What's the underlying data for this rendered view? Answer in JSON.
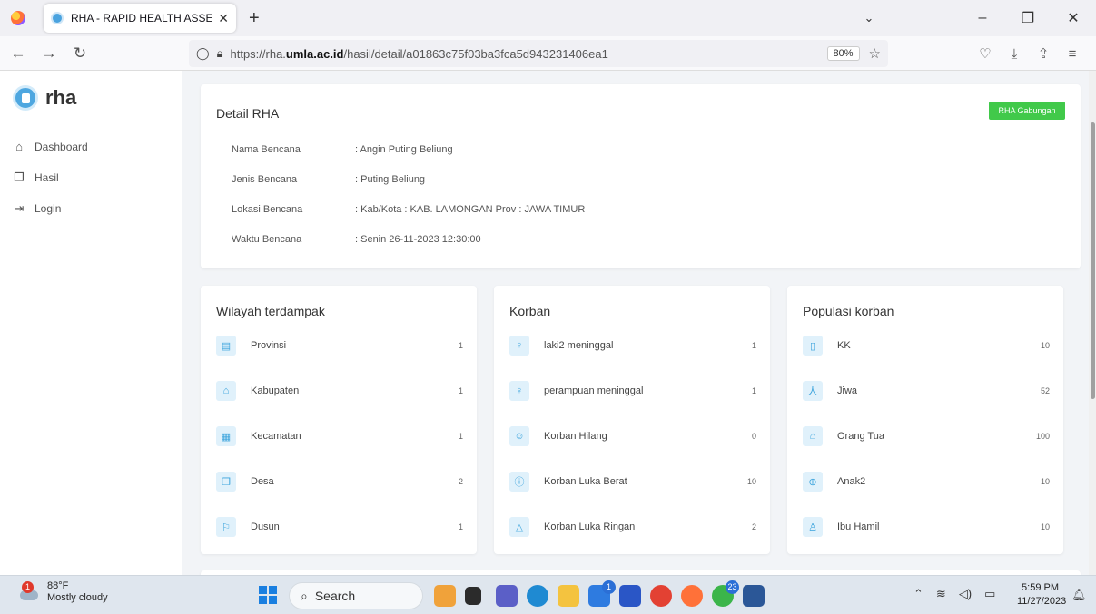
{
  "browser": {
    "tab_title": "RHA - RAPID HEALTH ASSESSM",
    "tab_close": "✕",
    "new_tab": "+",
    "url_prefix": "https://rha.",
    "url_domain": "umla.ac.id",
    "url_path": "/hasil/detail/a01863c75f03ba3fca5d943231406ea1",
    "zoom": "80%"
  },
  "sidebar": {
    "brand": "rha",
    "items": [
      {
        "label": "Dashboard",
        "icon": "home-icon"
      },
      {
        "label": "Hasil",
        "icon": "copy-icon"
      },
      {
        "label": "Login",
        "icon": "login-icon"
      }
    ]
  },
  "detail": {
    "title": "Detail RHA",
    "button": "RHA Gabungan",
    "rows": [
      {
        "label": "Nama Bencana",
        "value": ": Angin Puting Beliung"
      },
      {
        "label": "Jenis Bencana",
        "value": ": Puting Beliung"
      },
      {
        "label": "Lokasi Bencana",
        "value": ": Kab/Kota : KAB. LAMONGAN Prov : JAWA TIMUR"
      },
      {
        "label": "Waktu Bencana",
        "value": ": Senin 26-11-2023 12:30:00"
      }
    ]
  },
  "wilayah": {
    "title": "Wilayah terdampak",
    "items": [
      {
        "label": "Provinsi",
        "value": "1",
        "icon": "document-icon"
      },
      {
        "label": "Kabupaten",
        "value": "1",
        "icon": "home-icon"
      },
      {
        "label": "Kecamatan",
        "value": "1",
        "icon": "building-icon"
      },
      {
        "label": "Desa",
        "value": "2",
        "icon": "copy-icon"
      },
      {
        "label": "Dusun",
        "value": "1",
        "icon": "flag-icon"
      }
    ]
  },
  "korban": {
    "title": "Korban",
    "items": [
      {
        "label": "laki2 meninggal",
        "value": "1",
        "icon": "person-icon"
      },
      {
        "label": "perampuan meninggal",
        "value": "1",
        "icon": "person-icon"
      },
      {
        "label": "Korban Hilang",
        "value": "0",
        "icon": "user-search-icon"
      },
      {
        "label": "Korban Luka Berat",
        "value": "10",
        "icon": "alert-circle-icon"
      },
      {
        "label": "Korban Luka Ringan",
        "value": "2",
        "icon": "warning-icon"
      }
    ]
  },
  "populasi": {
    "title": "Populasi korban",
    "items": [
      {
        "label": "KK",
        "value": "10",
        "icon": "tablet-icon"
      },
      {
        "label": "Jiwa",
        "value": "52",
        "icon": "person-walk-icon"
      },
      {
        "label": "Orang Tua",
        "value": "100",
        "icon": "home-icon"
      },
      {
        "label": "Anak2",
        "value": "10",
        "icon": "plus-circle-icon"
      },
      {
        "label": "Ibu Hamil",
        "value": "10",
        "icon": "user-icon"
      }
    ]
  },
  "taskbar": {
    "weather_temp": "88°F",
    "weather_desc": "Mostly cloudy",
    "weather_badge": "1",
    "search_label": "Search",
    "badge_one": "1",
    "badge_two": "23",
    "time": "5:59 PM",
    "date": "11/27/2023"
  }
}
